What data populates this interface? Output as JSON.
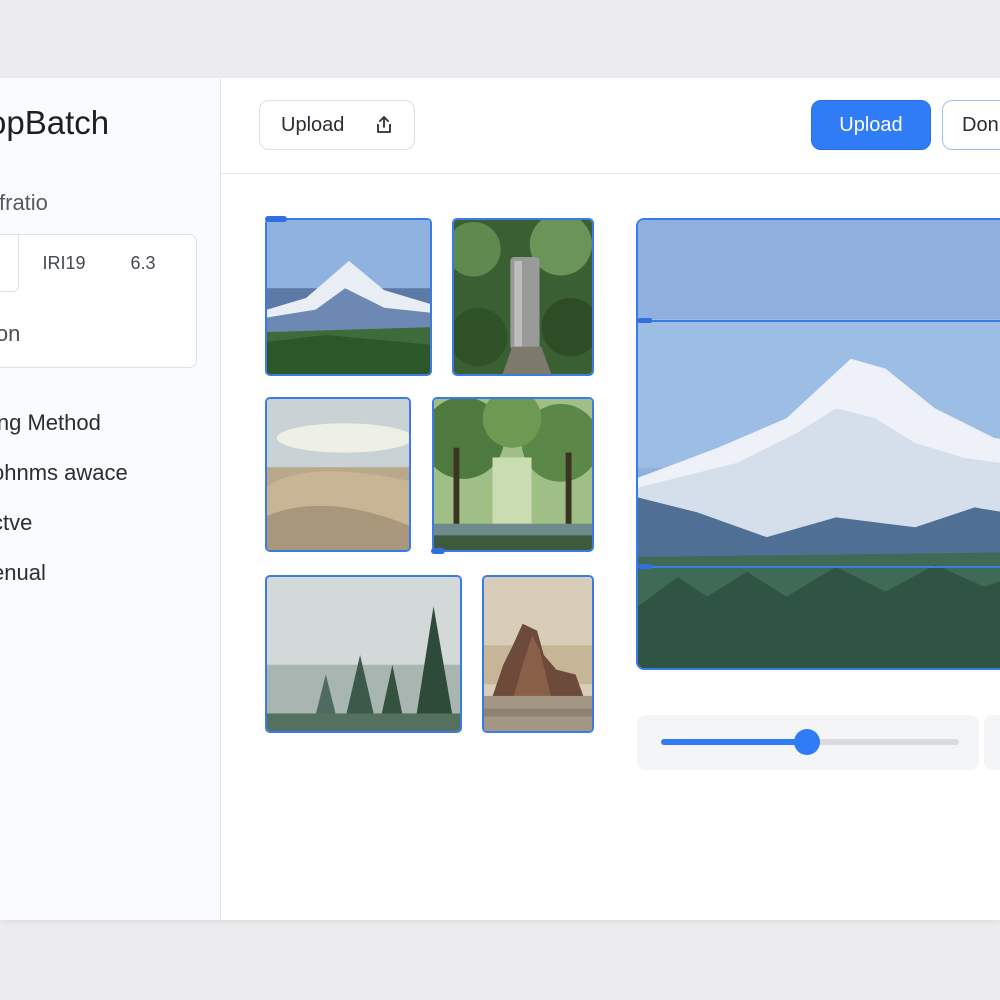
{
  "app": {
    "title": "opBatch"
  },
  "sidebar": {
    "ratio_label": "l fratio",
    "ratio_options": [
      "",
      "IRI19",
      "6.3"
    ],
    "ratio_caption": "ion",
    "methods": [
      "ing Method",
      "ohnms awace",
      "ctve",
      "enual"
    ]
  },
  "toolbar": {
    "upload_outline_label": "Upload",
    "upload_primary_label": "Upload",
    "done_label": "Don"
  },
  "slider": {
    "value_fraction": 0.49
  },
  "colors": {
    "accent": "#2f7cf6",
    "selection_border": "#3a7be8"
  },
  "thumbnails": [
    {
      "name": "mountain-thumbnail",
      "icon": "snow-mountain"
    },
    {
      "name": "forest-monolith-thumbnail",
      "icon": "forest-stone"
    },
    {
      "name": "desert-dunes-thumbnail",
      "icon": "dunes"
    },
    {
      "name": "forest-lake-thumbnail",
      "icon": "tree-lake"
    },
    {
      "name": "foggy-pines-thumbnail",
      "icon": "pines-fog"
    },
    {
      "name": "rock-formation-thumbnail",
      "icon": "rock"
    }
  ]
}
